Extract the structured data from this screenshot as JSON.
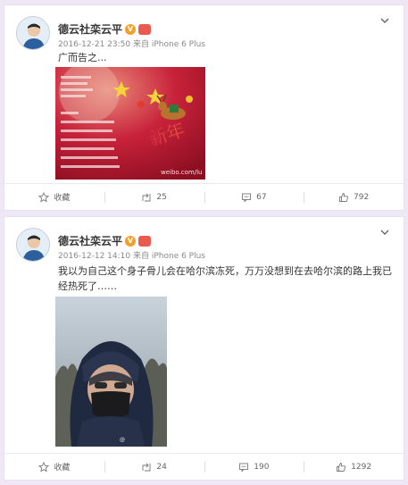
{
  "posts": [
    {
      "username": "德云社栾云平",
      "timestamp": "2016-12-21 23:50",
      "source": "来自 iPhone 6 Plus",
      "text": "广而告之...",
      "image_watermark": "weibo.com/lu",
      "actions": {
        "favorite_label": "收藏",
        "repost_count": "25",
        "comment_count": "67",
        "like_count": "792"
      }
    },
    {
      "username": "德云社栾云平",
      "timestamp": "2016-12-12 14:10",
      "source": "来自 iPhone 6 Plus",
      "text": "我以为自己这个身子骨儿会在哈尔滨冻死，万万没想到在去哈尔滨的路上我已经热死了……",
      "actions": {
        "favorite_label": "收藏",
        "repost_count": "24",
        "comment_count": "190",
        "like_count": "1292"
      }
    }
  ],
  "colors": {
    "page_bg": "#efe6f6",
    "verified": "#f2a02a",
    "poster_red": "#c8223a"
  }
}
